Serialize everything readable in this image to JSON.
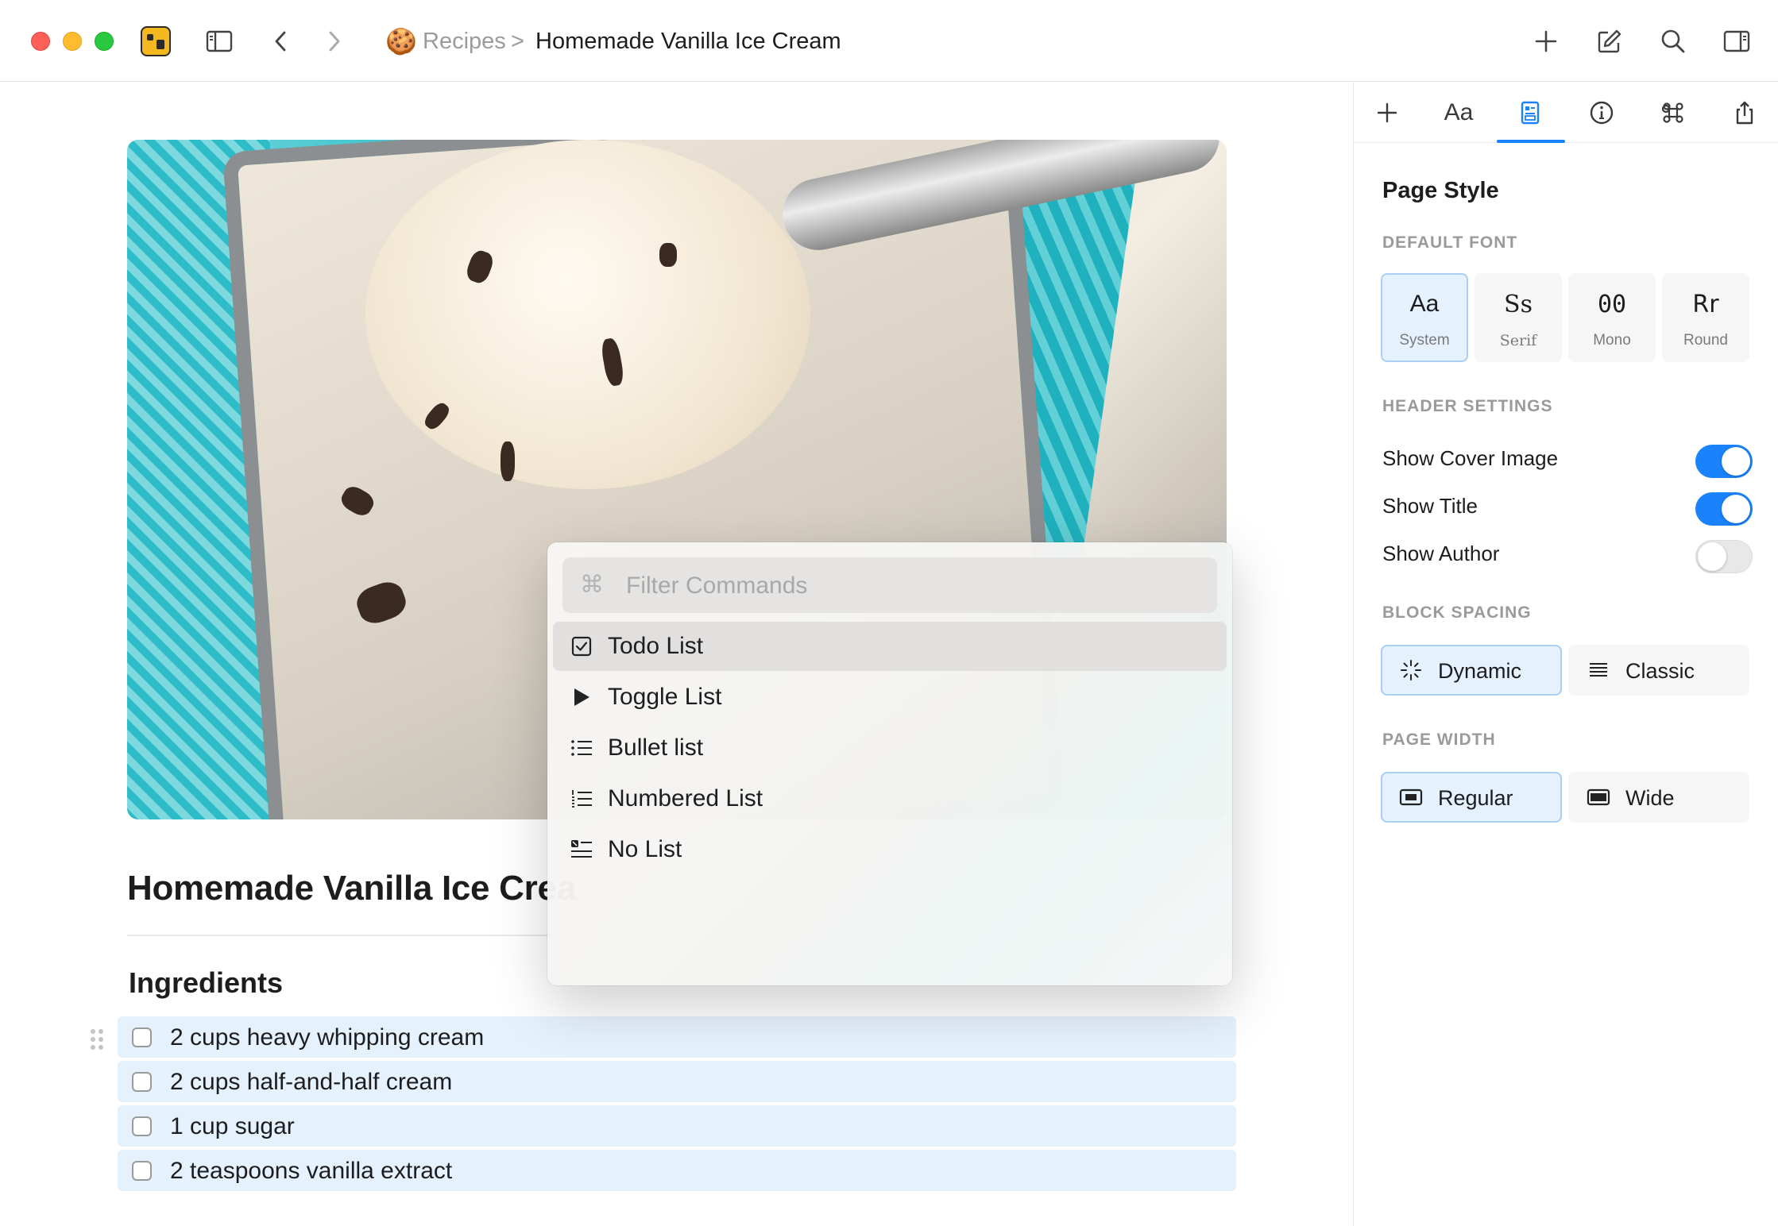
{
  "titlebar": {
    "icons": [
      "close-traffic-light",
      "minimize-traffic-light",
      "zoom-traffic-light",
      "app-icon",
      "sidebar-icon",
      "chevron-left-icon",
      "chevron-right-icon",
      "plus-icon",
      "compose-icon",
      "search-icon",
      "inspector-toggle-icon"
    ],
    "breadcrumb": {
      "emoji": "🍪",
      "parent": "Recipes",
      "separator": ">",
      "current": "Homemade Vanilla Ice Cream"
    }
  },
  "document": {
    "title": "Homemade Vanilla Ice Crea",
    "heading": "Ingredients",
    "todos": [
      {
        "text": "2 cups heavy whipping cream",
        "checked": false
      },
      {
        "text": "2 cups half-and-half cream",
        "checked": false
      },
      {
        "text": "1 cup sugar",
        "checked": false
      },
      {
        "text": "2 teaspoons vanilla extract",
        "checked": false
      }
    ]
  },
  "command_popup": {
    "filter_placeholder": "Filter Commands",
    "filter_icon": "⌘",
    "commands": [
      {
        "label": "Todo List",
        "icon": "checkbox-icon",
        "active": true
      },
      {
        "label": "Toggle List",
        "icon": "play-triangle-icon",
        "active": false
      },
      {
        "label": "Bullet list",
        "icon": "bullet-list-icon",
        "active": false
      },
      {
        "label": "Numbered List",
        "icon": "numbered-list-icon",
        "active": false
      },
      {
        "label": "No List",
        "icon": "no-list-icon",
        "active": false
      }
    ]
  },
  "inspector": {
    "tabs": [
      {
        "name": "add",
        "icon": "plus-icon"
      },
      {
        "name": "typography",
        "label": "Aa"
      },
      {
        "name": "page-style",
        "icon": "page-style-icon",
        "active": true
      },
      {
        "name": "info",
        "icon": "info-icon"
      },
      {
        "name": "shortcuts",
        "icon": "command-icon"
      },
      {
        "name": "share",
        "icon": "share-icon"
      }
    ],
    "title": "Page Style",
    "default_font": {
      "label": "DEFAULT FONT",
      "options": [
        {
          "glyph": "Aa",
          "name": "System",
          "selected": true
        },
        {
          "glyph": "Ss",
          "name": "Serif",
          "selected": false
        },
        {
          "glyph": "00",
          "name": "Mono",
          "selected": false
        },
        {
          "glyph": "Rr",
          "name": "Round",
          "selected": false
        }
      ]
    },
    "header_settings": {
      "label": "HEADER SETTINGS",
      "toggles": [
        {
          "label": "Show Cover Image",
          "on": true
        },
        {
          "label": "Show Title",
          "on": true
        },
        {
          "label": "Show Author",
          "on": false
        }
      ]
    },
    "block_spacing": {
      "label": "BLOCK SPACING",
      "options": [
        {
          "label": "Dynamic",
          "icon": "sparkle-icon",
          "selected": true
        },
        {
          "label": "Classic",
          "icon": "lines-icon",
          "selected": false
        }
      ]
    },
    "page_width": {
      "label": "PAGE WIDTH",
      "options": [
        {
          "label": "Regular",
          "icon": "regular-width-icon",
          "selected": true
        },
        {
          "label": "Wide",
          "icon": "wide-width-icon",
          "selected": false
        }
      ]
    }
  },
  "colors": {
    "accent": "#1a82fb",
    "selected_bg": "#e5f1fc",
    "todo_row_bg": "#e5f1fc"
  }
}
